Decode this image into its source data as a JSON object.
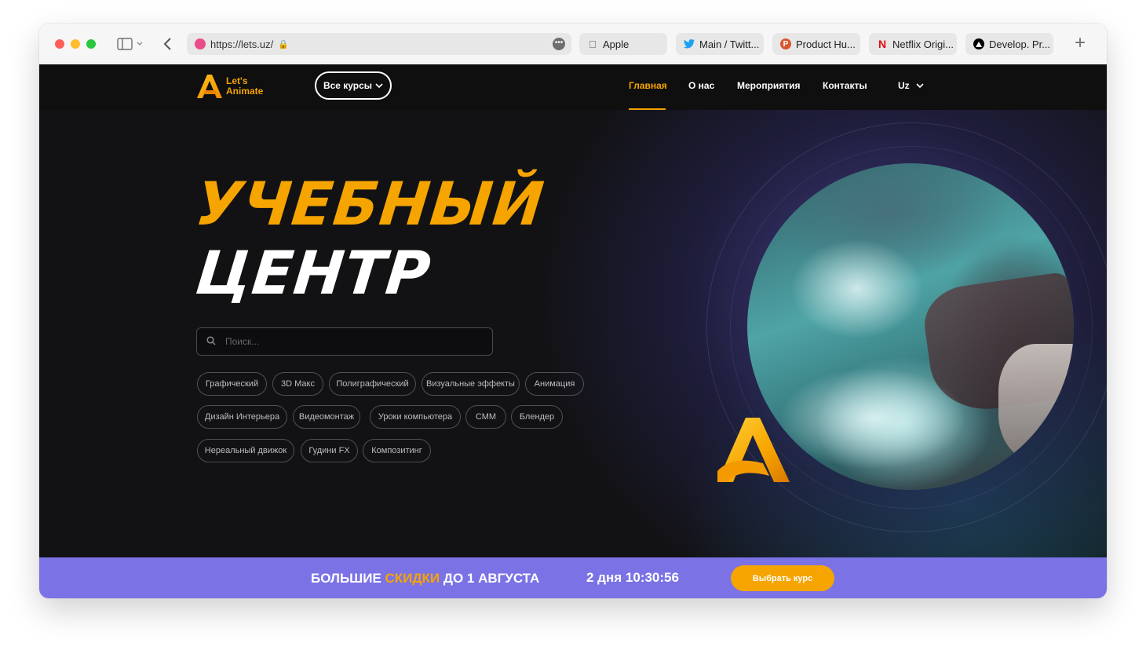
{
  "browser": {
    "url": "https://lets.uz/",
    "tabs": [
      {
        "label": "Apple",
        "icon": "apple-icon"
      },
      {
        "label": "Main / Twitt...",
        "icon": "twitter-icon"
      },
      {
        "label": "Product Hu...",
        "icon": "product-hunt-icon"
      },
      {
        "label": "Netflix Origi...",
        "icon": "netflix-icon"
      },
      {
        "label": "Develop. Pr...",
        "icon": "vercel-icon"
      }
    ]
  },
  "site": {
    "logo_line1": "Let's",
    "logo_line2": "Animate",
    "courses_button": "Все курсы",
    "nav": [
      {
        "label": "Главная",
        "active": true
      },
      {
        "label": "О нас"
      },
      {
        "label": "Мероприятия"
      },
      {
        "label": "Контакты"
      }
    ],
    "language": "Uz",
    "hero_line1": "УЧЕБНЫЙ",
    "hero_line2": "ЦЕНТР",
    "search_placeholder": "Поиск...",
    "chips": [
      [
        "Графический",
        "3D Макс",
        "Полиграфический",
        "Визуальные эффекты",
        "Анимация"
      ],
      [
        "Дизайн Интерьера",
        "Видеомонтаж",
        "Уроки компьютера",
        "СММ",
        "Блендер"
      ],
      [
        "Нереальный движок",
        "Гудини FX",
        "Композитинг"
      ]
    ]
  },
  "promo": {
    "text_before": "БОЛЬШИЕ ",
    "text_highlight": "СКИДКИ",
    "text_after": " ДО 1 АВГУСТА",
    "countdown": "2 дня 10:30:56",
    "button": "Выбрать курс"
  },
  "colors": {
    "accent": "#f5a400",
    "promo_bg": "#7b72e6",
    "page_bg": "#121214"
  }
}
